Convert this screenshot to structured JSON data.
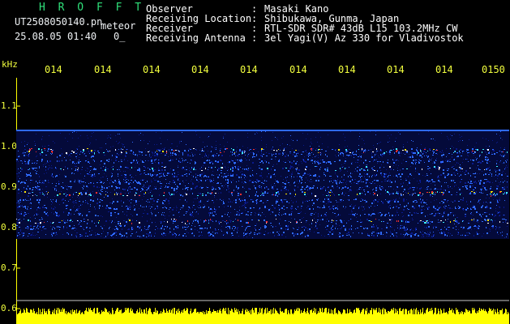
{
  "header": {
    "app_title": "H R O F F T",
    "file_name": "UT2508050140.pn",
    "meteor_label": "meteor",
    "datetime": "25.08.05 01:40",
    "count": "0_",
    "rows": [
      {
        "label": "Observer",
        "sep": ":",
        "value": "Masaki Kano"
      },
      {
        "label": "Receiving Location",
        "sep": ":",
        "value": "Shibukawa, Gunma, Japan"
      },
      {
        "label": "Receiver",
        "sep": ":",
        "value": "RTL-SDR SDR# 43dB L15 103.2MHz CW"
      },
      {
        "label": "Receiving Antenna",
        "sep": ":",
        "value": "3el Yagi(V) Az 330 for Vladivostok"
      }
    ]
  },
  "spectrogram": {
    "unit_label": "kHz",
    "y_ticks": [
      "1.1",
      "1.0",
      "0.9",
      "0.8",
      "0.7",
      "0.6"
    ],
    "x_ticks": [
      "014",
      "014",
      "014",
      "014",
      "014",
      "014",
      "014",
      "014",
      "014",
      "0150"
    ],
    "colors": {
      "background": "#000000",
      "noise_base": "#0a1a8c",
      "noise_mid": "#2f6bff",
      "accent_cyan": "#3cf0ff",
      "hot": "#ff3030",
      "signal_bar": "#ffff00",
      "axis": "#ffff00",
      "baseline": "#c8c8c8"
    }
  }
}
